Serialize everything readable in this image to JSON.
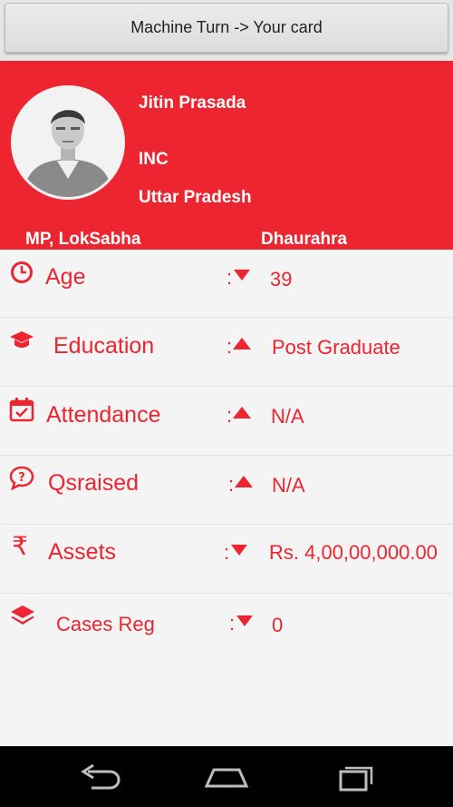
{
  "header": {
    "button_label": "Machine Turn -> Your card"
  },
  "profile": {
    "name": "Jitin Prasada",
    "party": "INC",
    "state": "Uttar Pradesh",
    "role": "MP, LokSabha",
    "constituency": "Dhaurahra"
  },
  "stats": [
    {
      "label": "Age",
      "icon": "clock-icon",
      "trend": "down",
      "value": "39"
    },
    {
      "label": "Education",
      "icon": "graduation-cap-icon",
      "trend": "up",
      "value": "Post Graduate"
    },
    {
      "label": "Attendance",
      "icon": "calendar-check-icon",
      "trend": "up",
      "value": "N/A"
    },
    {
      "label": "Qsraised",
      "icon": "question-bubble-icon",
      "trend": "up",
      "value": "N/A"
    },
    {
      "label": "Assets",
      "icon": "rupee-icon",
      "trend": "down",
      "value": "Rs. 4,00,00,000.00"
    },
    {
      "label": "Cases Reg",
      "icon": "layers-icon",
      "trend": "down",
      "value": "0"
    }
  ],
  "colors": {
    "accent": "#ec2530",
    "background": "#f4f4f4"
  },
  "navbar": {
    "back": "back-icon",
    "home": "home-icon",
    "recents": "recents-icon"
  }
}
